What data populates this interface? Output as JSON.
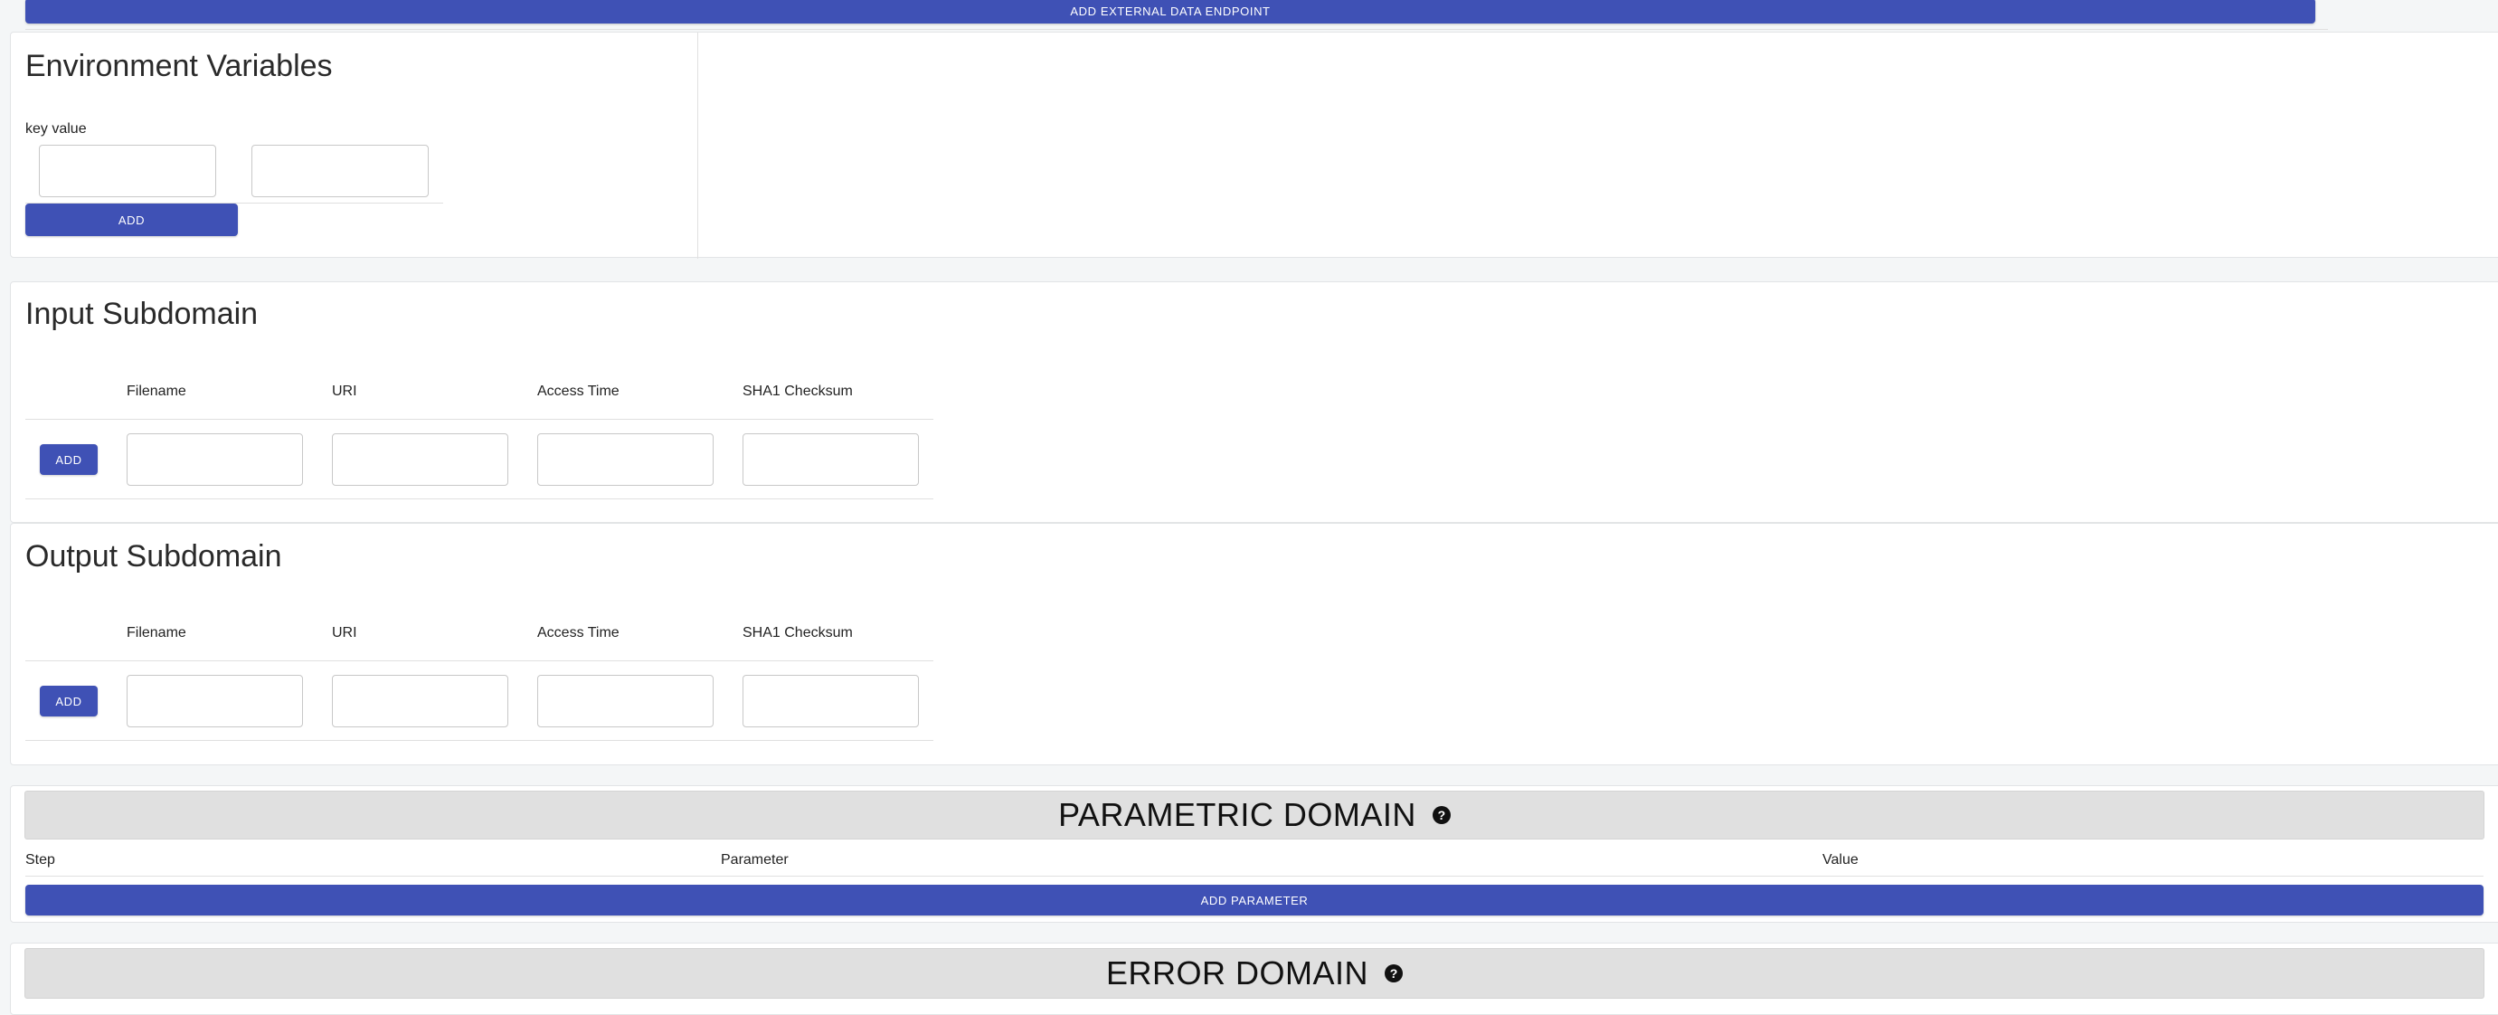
{
  "external_data": {
    "add_endpoint_label": "ADD EXTERNAL DATA ENDPOINT"
  },
  "environment_variables": {
    "title": "Environment Variables",
    "header": "key value",
    "add_label": "ADD"
  },
  "input_subdomain": {
    "title": "Input Subdomain",
    "columns": [
      "Filename",
      "URI",
      "Access Time",
      "SHA1 Checksum"
    ],
    "add_label": "ADD"
  },
  "output_subdomain": {
    "title": "Output Subdomain",
    "columns": [
      "Filename",
      "URI",
      "Access Time",
      "SHA1 Checksum"
    ],
    "add_label": "ADD"
  },
  "parametric_domain": {
    "title": "PARAMETRIC DOMAIN",
    "help_icon": "question-circle-icon",
    "columns": [
      "Step",
      "Parameter",
      "Value"
    ],
    "add_label": "ADD PARAMETER"
  },
  "error_domain": {
    "title": "ERROR DOMAIN",
    "help_icon": "question-circle-icon"
  },
  "colors": {
    "primary": "#3f51b5",
    "domain_bar": "#e0e0e0"
  }
}
